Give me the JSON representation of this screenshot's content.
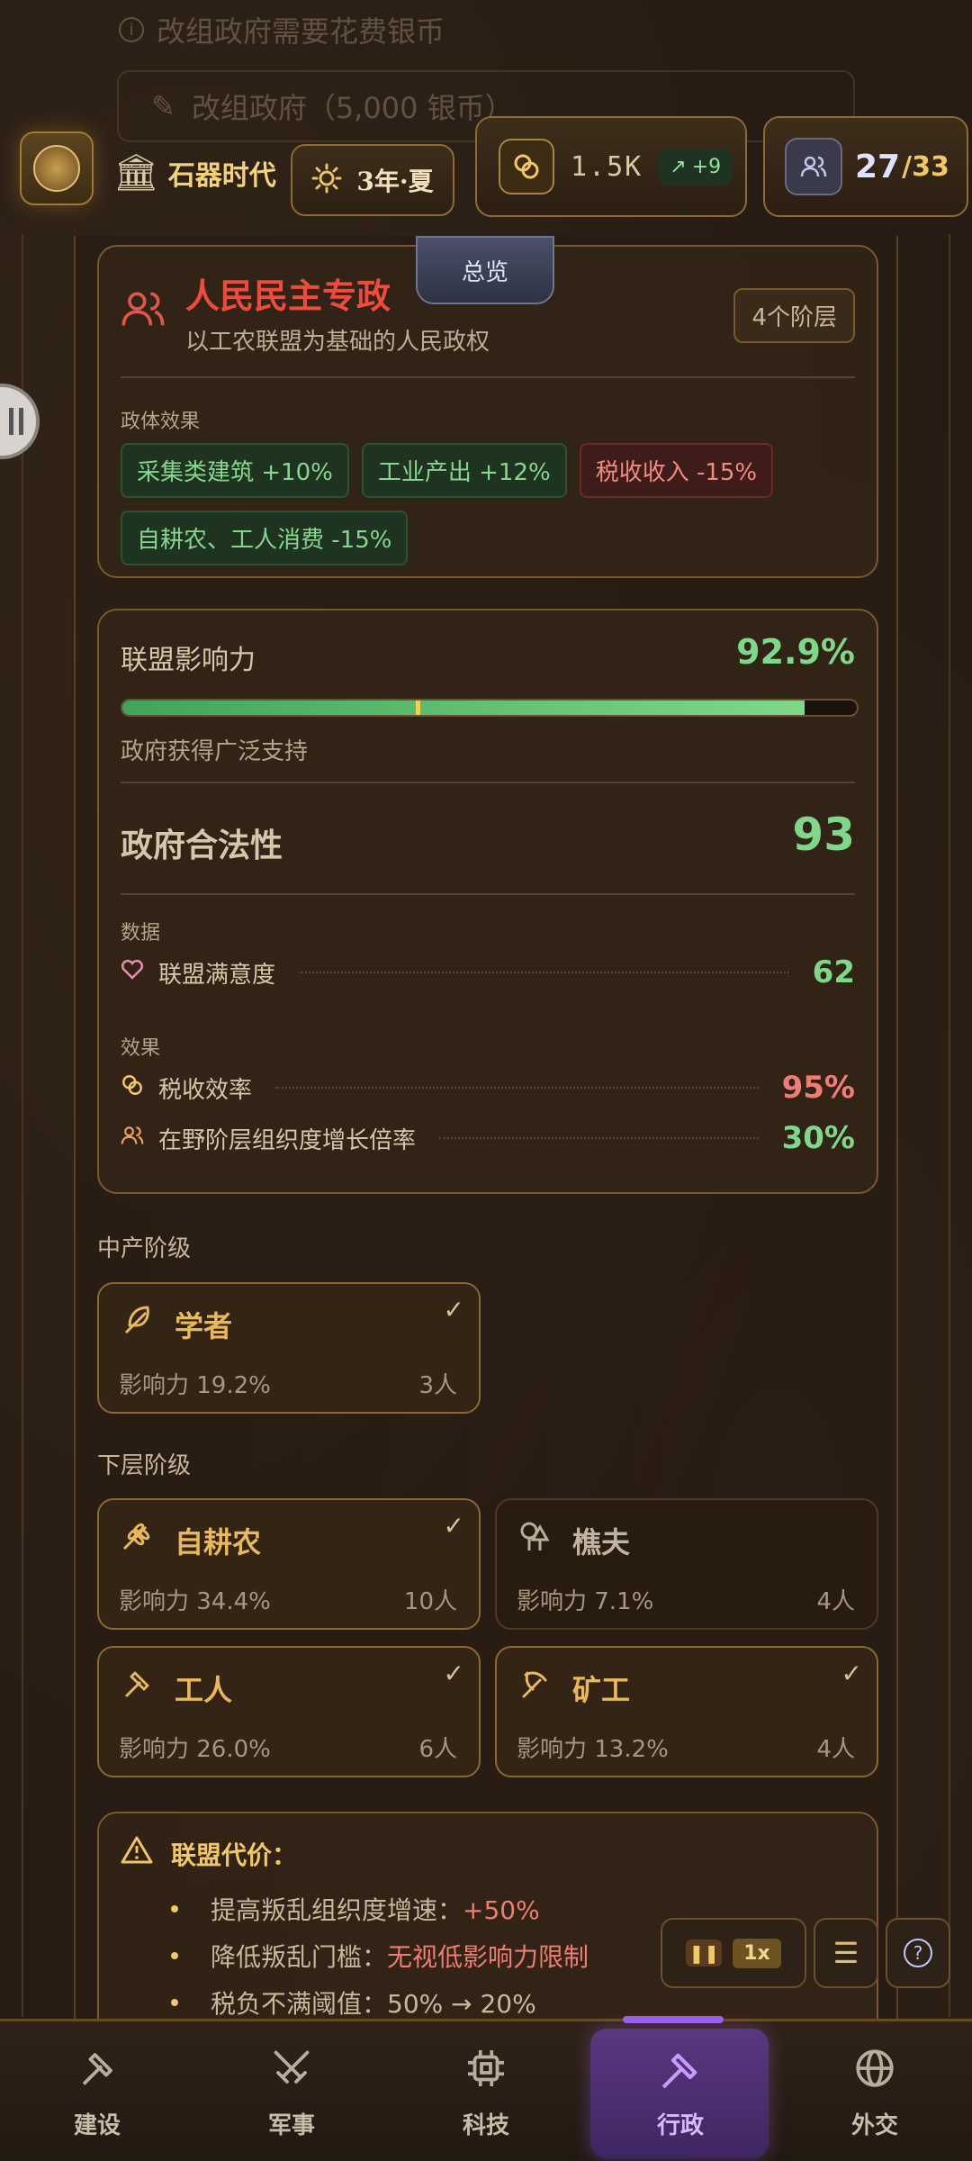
{
  "ghost": {
    "note": "改组政府需要花费银币",
    "button": "改组政府（5,000 银币）"
  },
  "topbar": {
    "era": "石器时代",
    "season": "3年·夏",
    "silver": "1.5K",
    "silver_delta": "+9",
    "population": "27",
    "population_max": "/33"
  },
  "tab": {
    "label": "总览"
  },
  "government": {
    "title": "人民民主专政",
    "subtitle": "以工农联盟为基础的人民政权",
    "badge": "4个阶层",
    "effects_label": "政体效果",
    "effects": [
      {
        "text": "采集类建筑 +10%",
        "type": "positive"
      },
      {
        "text": "工业产出 +12%",
        "type": "positive"
      },
      {
        "text": "税收收入 -15%",
        "type": "negative"
      },
      {
        "text": "自耕农、工人消费 -15%",
        "type": "positive"
      }
    ]
  },
  "legitimacy": {
    "influence_label": "联盟影响力",
    "influence_value": "92.9%",
    "influence_fraction": 0.929,
    "influence_marker_fraction": 0.4,
    "influence_note": "政府获得广泛支持",
    "legitimacy_label": "政府合法性",
    "legitimacy_value": "93",
    "data_label": "数据",
    "satisfaction_label": "联盟满意度",
    "satisfaction_value": "62",
    "effects_label": "效果",
    "tax_label": "税收效率",
    "tax_value": "95%",
    "org_label": "在野阶层组织度增长倍率",
    "org_value": "30%"
  },
  "middle_class": {
    "label": "中产阶级",
    "items": [
      {
        "name": "学者",
        "influence": "影响力 19.2%",
        "count": "3人",
        "active": true
      }
    ]
  },
  "lower_class": {
    "label": "下层阶级",
    "items": [
      {
        "name": "自耕农",
        "influence": "影响力 34.4%",
        "count": "10人",
        "active": true
      },
      {
        "name": "樵夫",
        "influence": "影响力 7.1%",
        "count": "4人",
        "active": false
      },
      {
        "name": "工人",
        "influence": "影响力 26.0%",
        "count": "6人",
        "active": true
      },
      {
        "name": "矿工",
        "influence": "影响力 13.2%",
        "count": "4人",
        "active": true
      }
    ]
  },
  "alliance_cost": {
    "title": "联盟代价：",
    "items": [
      {
        "label": "提高叛乱组织度增速：",
        "value": "+50%"
      },
      {
        "label": "降低叛乱门槛：",
        "value": "无视低影响力限制"
      },
      {
        "label": "税负不满阈值：50% → 20%",
        "value": ""
      }
    ]
  },
  "controls": {
    "speed": "1x"
  },
  "nav": {
    "items": [
      {
        "label": "建设",
        "icon": "hammer-icon"
      },
      {
        "label": "军事",
        "icon": "crossed-swords-icon"
      },
      {
        "label": "科技",
        "icon": "chip-icon"
      },
      {
        "label": "行政",
        "icon": "gavel-icon",
        "active": true
      },
      {
        "label": "外交",
        "icon": "globe-icon"
      }
    ]
  },
  "colors": {
    "accent": "#f2c766",
    "positive": "#7fd88a",
    "negative": "#ef7d73",
    "active_nav": "#9b5cf0"
  }
}
